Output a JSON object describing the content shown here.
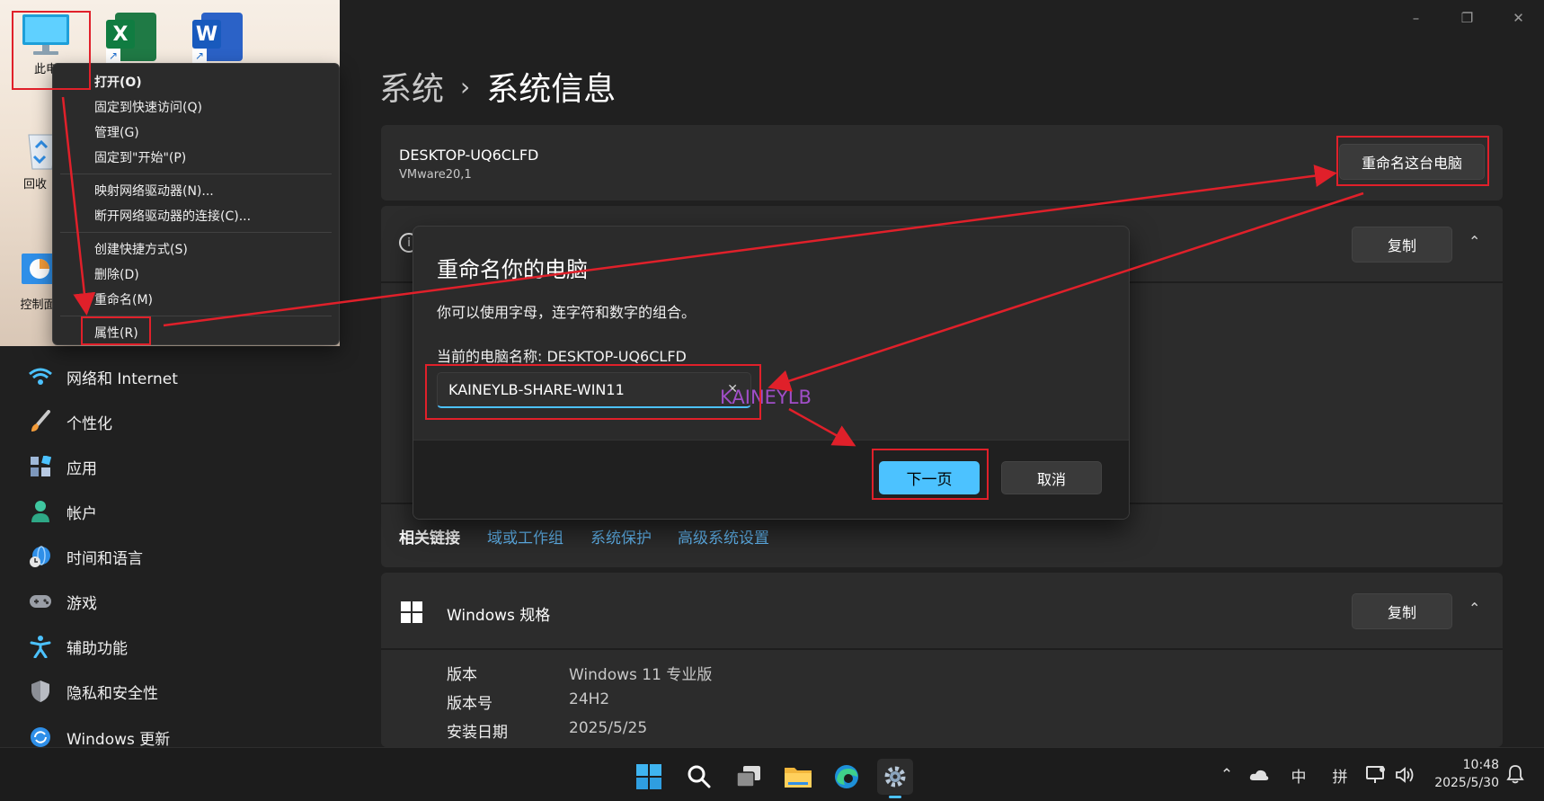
{
  "window": {
    "minimize": "–",
    "restore": "❐",
    "close": "✕"
  },
  "desktop": {
    "icons": [
      {
        "name": "this-pc",
        "label": "此电"
      },
      {
        "name": "recycle-bin",
        "label": "回收"
      },
      {
        "name": "control-panel",
        "label": "控制面"
      }
    ],
    "excel_letter": "X",
    "word_letter": "W"
  },
  "context_menu": {
    "items": [
      "打开(O)",
      "固定到快速访问(Q)",
      "管理(G)",
      "固定到\"开始\"(P)",
      "映射网络驱动器(N)...",
      "断开网络驱动器的连接(C)...",
      "创建快捷方式(S)",
      "删除(D)",
      "重命名(M)",
      "属性(R)"
    ]
  },
  "sidebar": {
    "items": [
      {
        "name": "network",
        "label": "网络和 Internet"
      },
      {
        "name": "personalization",
        "label": "个性化"
      },
      {
        "name": "apps",
        "label": "应用"
      },
      {
        "name": "accounts",
        "label": "帐户"
      },
      {
        "name": "time-language",
        "label": "时间和语言"
      },
      {
        "name": "gaming",
        "label": "游戏"
      },
      {
        "name": "accessibility",
        "label": "辅助功能"
      },
      {
        "name": "privacy-security",
        "label": "隐私和安全性"
      },
      {
        "name": "windows-update",
        "label": "Windows 更新"
      }
    ]
  },
  "header": {
    "parent": "系统",
    "separator": "›",
    "current": "系统信息"
  },
  "device": {
    "name": "DESKTOP-UQ6CLFD",
    "model": "VMware20,1",
    "rename_button": "重命名这台电脑"
  },
  "device_specs": {
    "info_icon": "i",
    "copy_button": "复制",
    "chevron": "⌃"
  },
  "related": {
    "label": "相关链接",
    "links": [
      "域或工作组",
      "系统保护",
      "高级系统设置"
    ]
  },
  "windows_spec": {
    "title": "Windows 规格",
    "copy_button": "复制",
    "chevron": "⌃",
    "rows": [
      {
        "key": "版本",
        "value": "Windows 11 专业版"
      },
      {
        "key": "版本号",
        "value": "24H2"
      },
      {
        "key": "安装日期",
        "value": "2025/5/25"
      }
    ]
  },
  "dialog": {
    "title": "重命名你的电脑",
    "description": "你可以使用字母，连字符和数字的组合。",
    "current_name": "当前的电脑名称: DESKTOP-UQ6CLFD",
    "input_value": "KAINEYLB-SHARE-WIN11",
    "clear": "✕",
    "next_button": "下一页",
    "cancel_button": "取消"
  },
  "watermark": "KAINEYLB",
  "taskbar": {
    "tray": {
      "chevron": "⌃",
      "ime_lang": "中",
      "ime_mode": "拼",
      "time": "10:48",
      "date": "2025/5/30"
    }
  },
  "colors": {
    "accent": "#4cc2ff",
    "highlight": "#e0202a",
    "link": "#62b7f2"
  }
}
